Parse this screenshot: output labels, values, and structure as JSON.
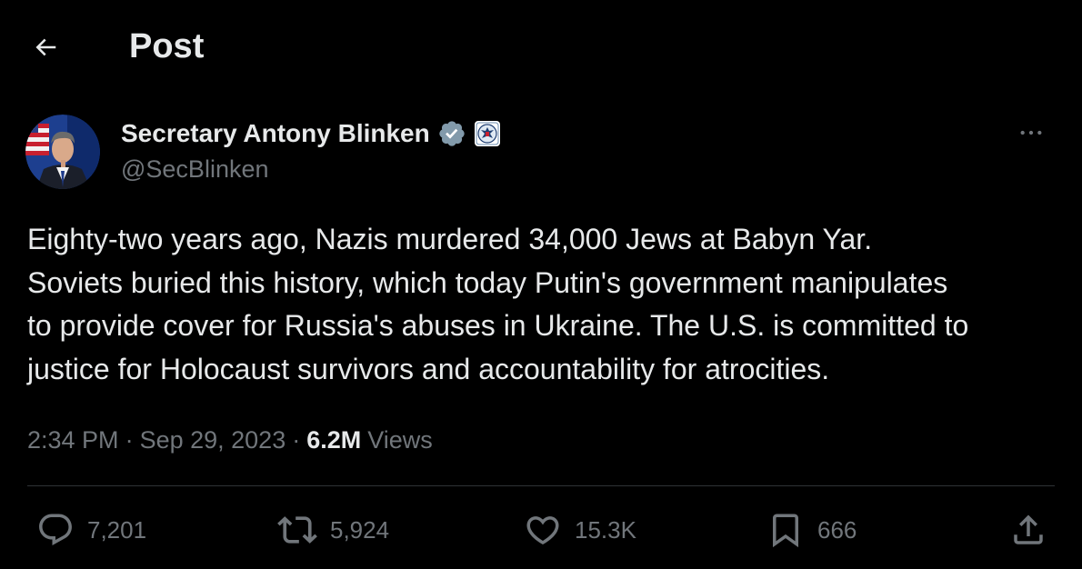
{
  "header": {
    "title": "Post",
    "back_icon": "arrow-left-icon"
  },
  "author": {
    "name": "Secretary Antony Blinken",
    "handle": "@SecBlinken",
    "verified_icon": "verified-badge-icon",
    "affiliation_icon": "us-state-department-seal-icon",
    "verified_color": "#829aab"
  },
  "tweet": {
    "lines": [
      "Eighty-two years ago, Nazis murdered 34,000 Jews at Babyn Yar.",
      "Soviets buried this history, which today Putin's government manipulates",
      "to provide cover for Russia's abuses in Ukraine. The U.S. is committed to",
      "justice for Holocaust survivors and accountability for atrocities."
    ]
  },
  "meta": {
    "time": "2:34 PM",
    "separator": "·",
    "date": "Sep 29, 2023",
    "views_count": "6.2M",
    "views_label": "Views"
  },
  "actions": {
    "reply": {
      "icon": "reply-icon",
      "count": "7,201"
    },
    "retweet": {
      "icon": "retweet-icon",
      "count": "5,924"
    },
    "like": {
      "icon": "heart-icon",
      "count": "15.3K"
    },
    "bookmark": {
      "icon": "bookmark-icon",
      "count": "666"
    },
    "share": {
      "icon": "share-icon"
    }
  },
  "colors": {
    "background": "#000000",
    "primary_text": "#e7e9ea",
    "secondary_text": "#71767b",
    "divider": "#2f3336"
  }
}
